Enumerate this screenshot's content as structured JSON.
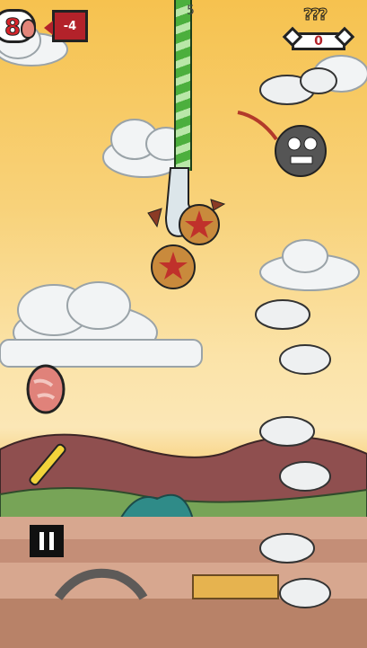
{
  "hud": {
    "egg_count": "8",
    "penalty": "-4",
    "timer": "5",
    "best_label": "???",
    "score": "0"
  },
  "colors": {
    "sky_top": "#f6c24f",
    "sky_bottom": "#fbe7b6",
    "rope_green": "#4caf3d",
    "hud_red": "#b3222a"
  },
  "icons": {
    "pause": "pause-icon",
    "bomb": "bomb-icon",
    "egg": "egg-icon",
    "bonus_stick": "firecracker-icon"
  }
}
